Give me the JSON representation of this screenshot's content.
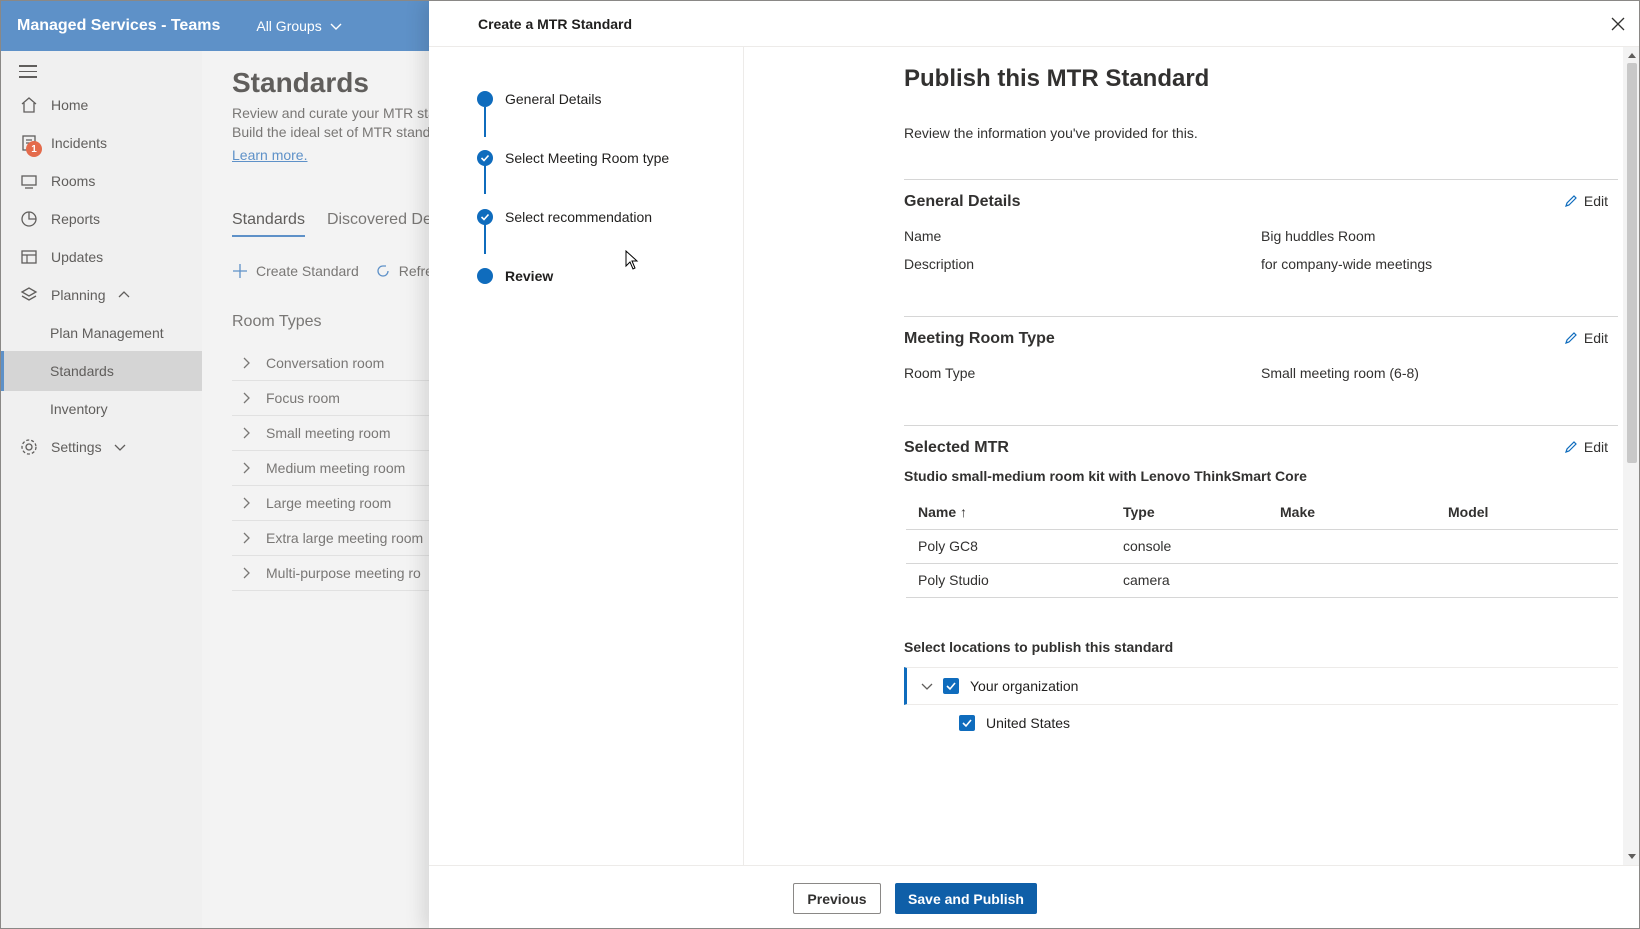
{
  "app": {
    "title": "Managed Services - Teams",
    "group_selector": "All Groups"
  },
  "sidebar": {
    "items": [
      {
        "label": "Home",
        "icon": "home-icon"
      },
      {
        "label": "Incidents",
        "icon": "incidents-icon",
        "badge": "1"
      },
      {
        "label": "Rooms",
        "icon": "rooms-icon"
      },
      {
        "label": "Reports",
        "icon": "reports-icon"
      },
      {
        "label": "Updates",
        "icon": "updates-icon"
      },
      {
        "label": "Planning",
        "icon": "planning-icon"
      },
      {
        "label": "Plan Management"
      },
      {
        "label": "Standards"
      },
      {
        "label": "Inventory"
      },
      {
        "label": "Settings",
        "icon": "settings-icon"
      }
    ]
  },
  "main": {
    "title": "Standards",
    "desc_line1": "Review and curate your MTR sta",
    "desc_line2": "Build the ideal set of MTR standa",
    "learn_more": "Learn more.",
    "tabs": [
      "Standards",
      "Discovered Dev"
    ],
    "commands": [
      "Create Standard",
      "Refre"
    ],
    "room_types_title": "Room Types",
    "room_types": [
      "Conversation room",
      "Focus room",
      "Small meeting room",
      "Medium meeting room",
      "Large meeting room",
      "Extra large meeting room",
      "Multi-purpose meeting ro"
    ]
  },
  "panel": {
    "title": "Create a MTR Standard",
    "steps": [
      "General Details",
      "Select Meeting Room type",
      "Select recommendation",
      "Review"
    ],
    "heading": "Publish this MTR Standard",
    "intro": "Review the information you've provided for this.",
    "edit_label": "Edit",
    "general": {
      "title": "General Details",
      "name_label": "Name",
      "name_value": "Big huddles Room",
      "desc_label": "Description",
      "desc_value": "for company-wide meetings"
    },
    "room_type": {
      "title": "Meeting Room Type",
      "label": "Room Type",
      "value": "Small meeting room (6-8)"
    },
    "mtr": {
      "title": "Selected MTR",
      "subtitle": "Studio small-medium room kit with Lenovo ThinkSmart Core",
      "columns": [
        "Name",
        "Type",
        "Make",
        "Model"
      ],
      "rows": [
        [
          "Poly GC8",
          "console",
          "",
          ""
        ],
        [
          "Poly Studio",
          "camera",
          "",
          ""
        ]
      ]
    },
    "locations": {
      "title": "Select locations to publish this standard",
      "items": [
        "Your organization",
        "United States"
      ]
    },
    "footer": {
      "previous": "Previous",
      "save": "Save and Publish"
    }
  },
  "colors": {
    "accent": "#0f6cbd",
    "topbar": "#5e91c8",
    "badge": "#e46b4c"
  }
}
